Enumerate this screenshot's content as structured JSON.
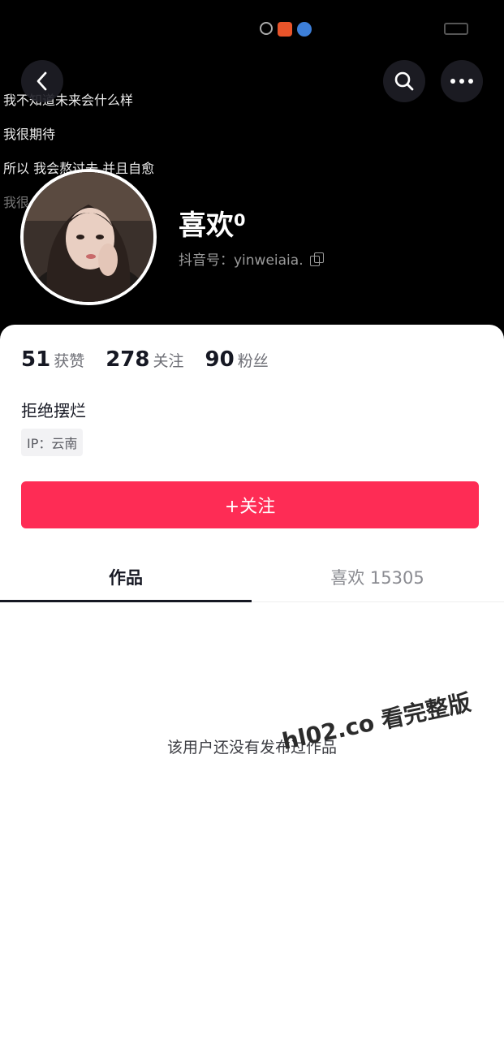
{
  "status_bar": {
    "icons": [
      "hotspot-icon",
      "app-icon-red",
      "app-icon-blue"
    ],
    "battery": "battery-icon"
  },
  "header": {
    "back": "chevron-left-icon",
    "search": "search-icon",
    "more": "more-horizontal-icon"
  },
  "background_lines": [
    "我不知道未来会什么样",
    "我很期待",
    "所以 我会熬过去 并且自愈",
    "我很"
  ],
  "profile": {
    "nickname": "喜欢⁰",
    "account": "抖音号：yinweiaia.",
    "avatar": "avatar-photo"
  },
  "stats": [
    {
      "value": "51",
      "label": "获赞"
    },
    {
      "value": "278",
      "label": "关注"
    },
    {
      "value": "90",
      "label": "粉丝"
    }
  ],
  "bio": "拒绝摆烂",
  "ip": "IP：云南",
  "follow_button": "+关注",
  "tabs": [
    {
      "label": "作品",
      "active": true
    },
    {
      "label": "喜欢 15305",
      "active": false
    }
  ],
  "empty_state": "该用户还没有发布过作品",
  "watermark": "hl02.co 看完整版",
  "colors": {
    "accent": "#fe2c55",
    "background_top": "#000000",
    "panel": "#ffffff"
  }
}
